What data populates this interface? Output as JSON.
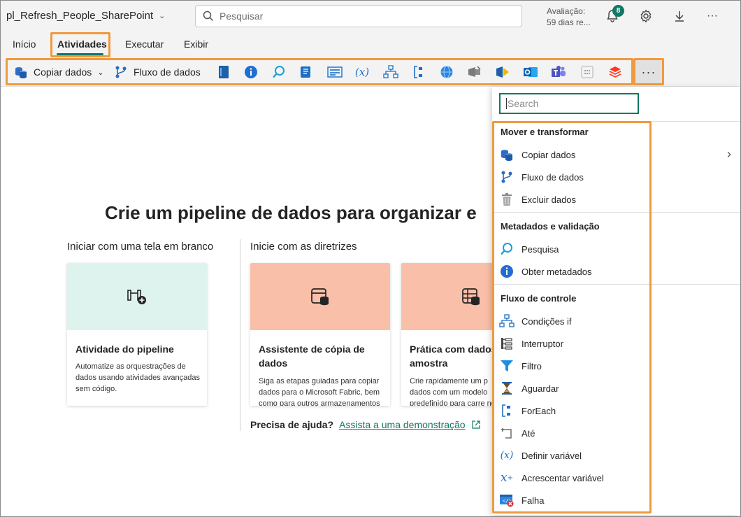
{
  "header": {
    "item_title": "pl_Refresh_People_SharePoint",
    "search_placeholder": "Pesquisar",
    "trial_label": "Avaliação:",
    "trial_days": "59 dias re...",
    "notification_count": "8"
  },
  "tabs": [
    {
      "label": "Início"
    },
    {
      "label": "Atividades"
    },
    {
      "label": "Executar"
    },
    {
      "label": "Exibir"
    }
  ],
  "ribbon": {
    "copy_data": "Copiar dados",
    "dataflow": "Fluxo de dados",
    "more": "···",
    "icons": [
      "notebook-icon",
      "info-icon",
      "lookup-icon",
      "script-icon",
      "stored-procedure-icon",
      "variable-icon",
      "if-condition-icon",
      "foreach-icon",
      "web-icon",
      "webhook-icon",
      "azure-function-icon",
      "outlook-icon",
      "teams-icon",
      "kql-icon",
      "databricks-icon"
    ]
  },
  "canvas": {
    "headline": "Crie um pipeline de dados para organizar e",
    "blank_label": "Iniciar com uma tela em branco",
    "guided_label": "Inicie com as diretrizes",
    "cards": [
      {
        "title": "Atividade do pipeline",
        "desc": "Automatize as orquestrações de dados usando atividades avançadas sem código."
      },
      {
        "title": "Assistente de cópia de dados",
        "desc": "Siga as etapas guiadas para copiar dados para o Microsoft Fabric, bem como para outros armazenamentos de dados."
      },
      {
        "title": "Prática com dados amostra",
        "desc": "Crie rapidamente um p dados com um modelo predefinido para carre no Lakehouse."
      }
    ],
    "help_label": "Precisa de ajuda?",
    "help_link": "Assista a uma demonstração"
  },
  "panel": {
    "search_placeholder": "Search",
    "groups": [
      {
        "label": "Mover e transformar",
        "items": [
          "Copiar dados",
          "Fluxo de dados",
          "Excluir dados"
        ]
      },
      {
        "label": "Metadados e validação",
        "items": [
          "Pesquisa",
          "Obter metadados"
        ]
      },
      {
        "label": "Fluxo de controle",
        "items": [
          "Condições if",
          "Interruptor",
          "Filtro",
          "Aguardar",
          "ForEach",
          "Até",
          "Definir variável",
          "Acrescentar variável",
          "Falha"
        ]
      }
    ]
  },
  "colors": {
    "accent": "#117865",
    "highlight": "#f09a3e",
    "card_green": "#dff3ee",
    "card_salmon": "#f9bfa9"
  }
}
